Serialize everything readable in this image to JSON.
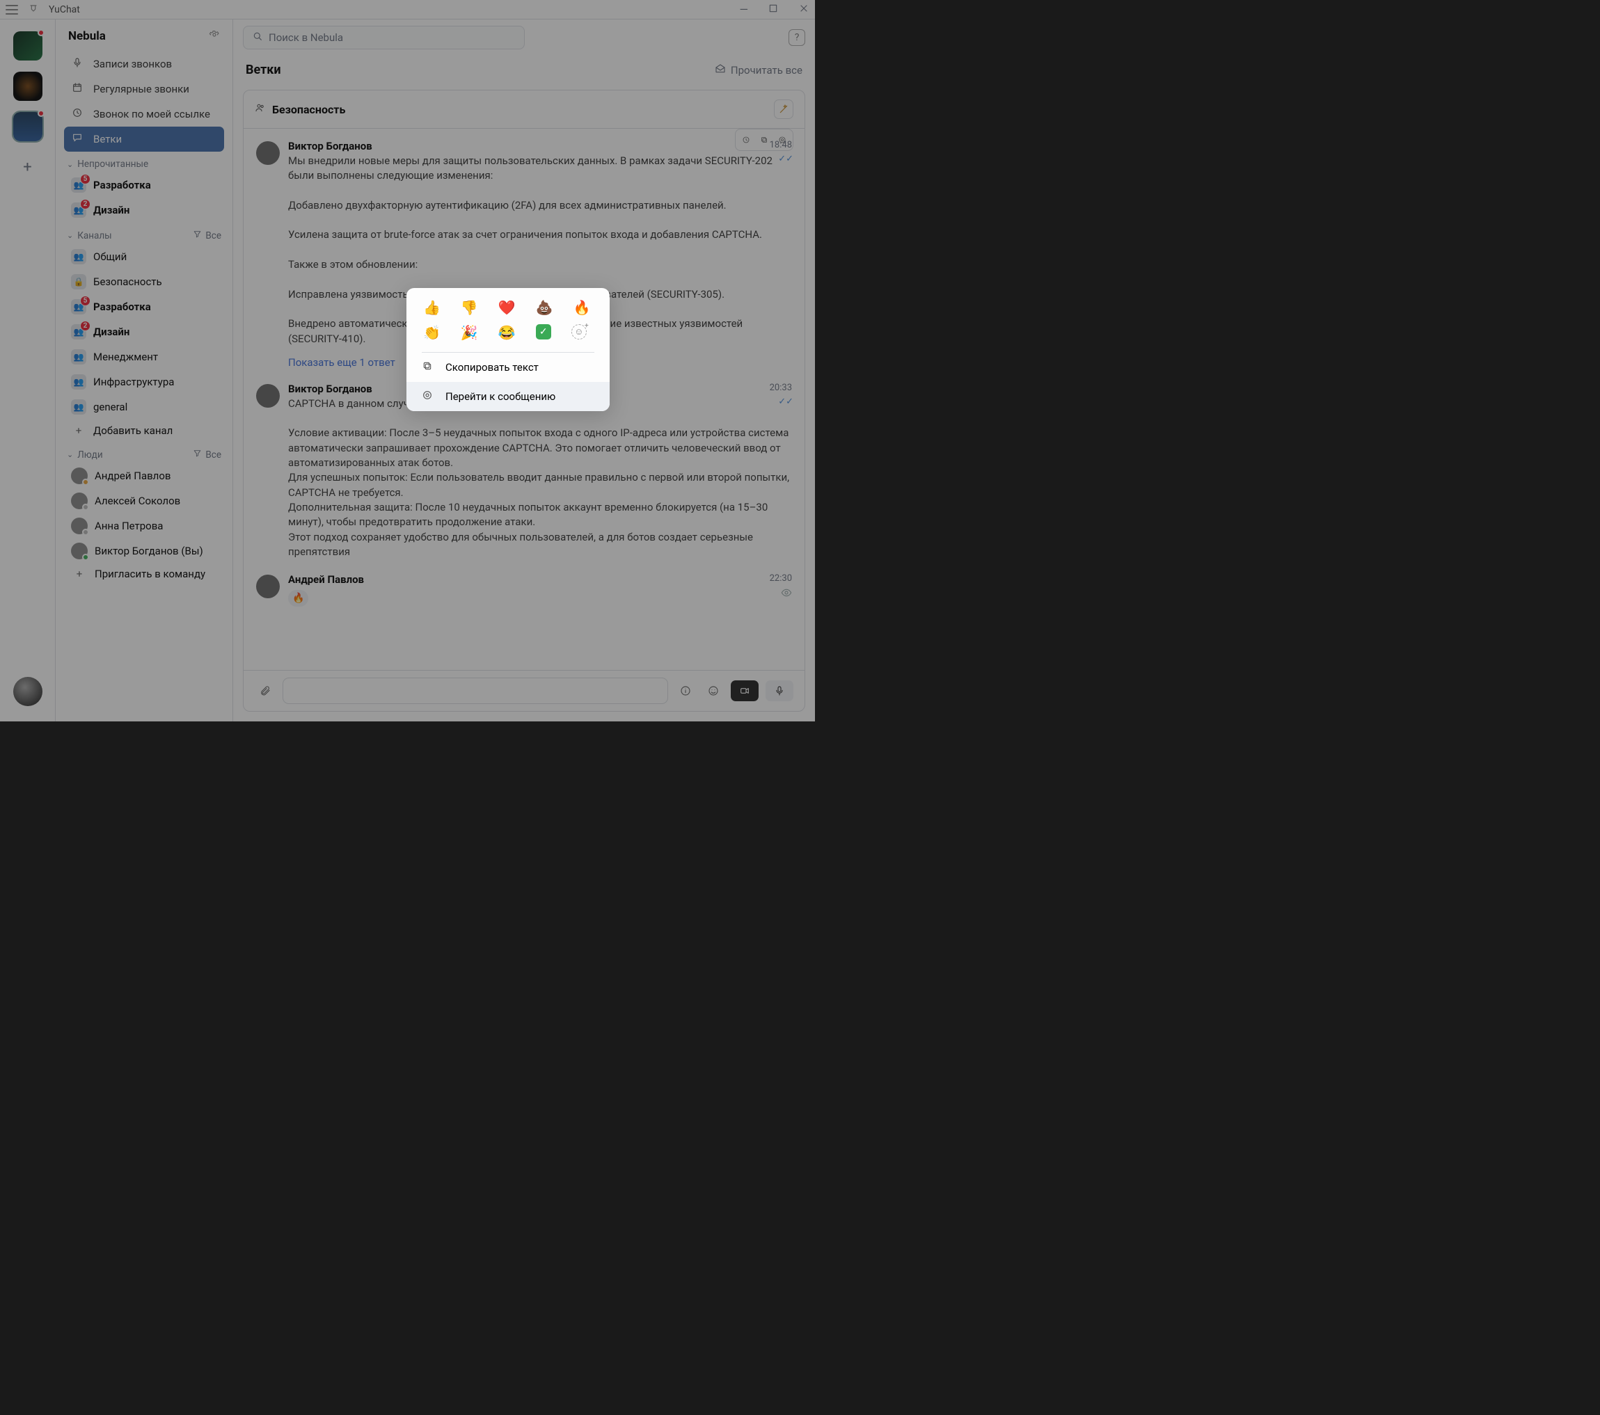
{
  "titlebar": {
    "appname": "YuChat"
  },
  "workspace": {
    "name": "Nebula",
    "nav": [
      {
        "icon": "mic-icon",
        "label": "Записи звонков"
      },
      {
        "icon": "calendar-icon",
        "label": "Регулярные звонки"
      },
      {
        "icon": "clock-icon",
        "label": "Звонок по моей ссылке"
      },
      {
        "icon": "chat-icon",
        "label": "Ветки",
        "selected": true
      }
    ],
    "sections": {
      "unread": {
        "title": "Непрочитанные",
        "items": [
          {
            "label": "Разработка",
            "badge": "5"
          },
          {
            "label": "Дизайн",
            "badge": "2"
          }
        ]
      },
      "channels": {
        "title": "Каналы",
        "filter": "Все",
        "items": [
          {
            "label": "Общий",
            "icon": "people"
          },
          {
            "label": "Безопасность",
            "icon": "lock"
          },
          {
            "label": "Разработка",
            "icon": "people",
            "badge": "5",
            "bold": true
          },
          {
            "label": "Дизайн",
            "icon": "people",
            "badge": "2",
            "bold": true
          },
          {
            "label": "Менеджмент",
            "icon": "people"
          },
          {
            "label": "Инфраструктура",
            "icon": "people"
          },
          {
            "label": "general",
            "icon": "people"
          }
        ],
        "add": "Добавить канал"
      },
      "people": {
        "title": "Люди",
        "filter": "Все",
        "items": [
          {
            "label": "Андрей Павлов",
            "status": "#e8a33a"
          },
          {
            "label": "Алексей Соколов",
            "status": "#bbb"
          },
          {
            "label": "Анна Петрова",
            "status": "#bbb"
          },
          {
            "label": "Виктор Богданов (Вы)",
            "status": "#3aaa55"
          }
        ],
        "invite": "Пригласить в команду"
      }
    }
  },
  "search": {
    "placeholder": "Поиск в Nebula"
  },
  "threads": {
    "title": "Ветки",
    "read_all": "Прочитать все",
    "channel": "Безопасность",
    "show_more": "Показать еще 1 ответ",
    "messages": [
      {
        "author": "Виктор Богданов",
        "time": "18:48",
        "read": true,
        "text": "Мы внедрили новые меры для защиты пользовательских данных. В рамках задачи SECURITY-202 были выполнены следующие изменения:\n\nДобавлено двухфакторную аутентификацию (2FA) для всех административных панелей.\n\nУсилена защита от brute-force атак за счет ограничения попыток входа и добавления CAPTCHA.\n\nТакже в этом обновлении:\n\nИсправлена уязвимость, связанная с экспортом данных пользователей (SECURITY-305).\n\nВнедрено автоматическое сканирование зависимостей на наличие известных уязвимостей (SECURITY-410)."
      },
      {
        "author": "Виктор Богданов",
        "time": "20:33",
        "read": true,
        "text": "CAPTCHA в данном случае работает так:\n\nУсловие активации: После 3–5 неудачных попыток входа с одного IP-адреса или устройства система автоматически запрашивает прохождение CAPTCHA. Это помогает отличить человеческий ввод от автоматизированных атак ботов.\nДля успешных попыток: Если пользователь вводит данные правильно с первой или второй попытки, CAPTCHA не требуется.\nДополнительная защита: После 10 неудачных попыток аккаунт временно блокируется (на 15–30 минут), чтобы предотвратить продолжение атаки.\nЭтот подход сохраняет удобство для обычных пользователей, а для ботов создает серьезные препятствия"
      },
      {
        "author": "Андрей Павлов",
        "time": "22:30",
        "seen": true,
        "reaction": "🔥"
      }
    ]
  },
  "context_menu": {
    "emojis_row1": [
      "👍",
      "👎",
      "❤️",
      "💩",
      "🔥"
    ],
    "emojis_row2": [
      "👏",
      "🎉",
      "😂"
    ],
    "items": [
      {
        "icon": "copy-icon",
        "label": "Скопировать текст"
      },
      {
        "icon": "target-icon",
        "label": "Перейти к сообщению",
        "hilite": true
      }
    ]
  }
}
